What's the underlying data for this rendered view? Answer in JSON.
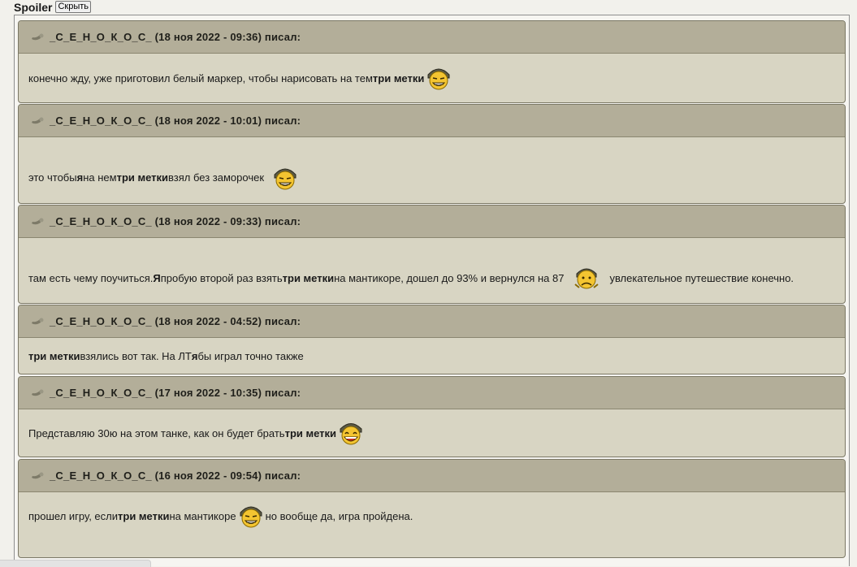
{
  "spoiler": {
    "title": "Spoiler",
    "toggle_label": "Скрыть"
  },
  "colors": {
    "quote_header": "#b3ae99",
    "quote_body": "#d8d5c3",
    "border": "#7b7865"
  },
  "quotes": [
    {
      "author": "_С_Е_Н_О_К_О_С_ (18 ноя 2022 - 09:36) писал:",
      "text_1": "конечно жду, уже приготовил белый маркер, чтобы нарисовать на тем ",
      "bold_1": "три метки",
      "smiley": "grinning-tanker-smiley-icon"
    },
    {
      "author": "_С_Е_Н_О_К_О_С_ (18 ноя 2022 - 10:01) писал:",
      "text_1": "это чтобы ",
      "bold_1": "я",
      "text_2": " на нем ",
      "bold_2": "три метки",
      "text_3": " взял без заморочек",
      "smiley": "grinning-tanker-smiley-icon"
    },
    {
      "author": "_С_Е_Н_О_К_О_С_ (18 ноя 2022 - 09:33) писал:",
      "text_1": "там есть чему поучиться. ",
      "bold_1": "Я",
      "text_2": " пробую второй раз взять ",
      "bold_2": "три метки",
      "text_3": " на мантикоре, дошел до 93% и вернулся на 87",
      "text_4": "увлекательное путешествие конечно.",
      "smiley": "sad-tanker-smiley-icon"
    },
    {
      "author": "_С_Е_Н_О_К_О_С_ (18 ноя 2022 - 04:52) писал:",
      "bold_1": "три метки",
      "text_1": " взялись вот так. На ЛТ ",
      "bold_2": "я",
      "text_2": " бы играл точно также"
    },
    {
      "author": "_С_Е_Н_О_К_О_С_ (17 ноя 2022 - 10:35) писал:",
      "text_1": "Представляю 30ю на этом танке, как он будет брать ",
      "bold_1": "три метки",
      "smiley": "laughing-tanker-smiley-icon"
    },
    {
      "author": "_С_Е_Н_О_К_О_С_ (16 ноя 2022 - 09:54) писал:",
      "text_1": "прошел игру, если ",
      "bold_1": "три метки",
      "text_2": " на мантикоре",
      "text_3": " но вообще да, игра пройдена.",
      "smiley": "grinning-tanker-smiley-icon"
    }
  ]
}
